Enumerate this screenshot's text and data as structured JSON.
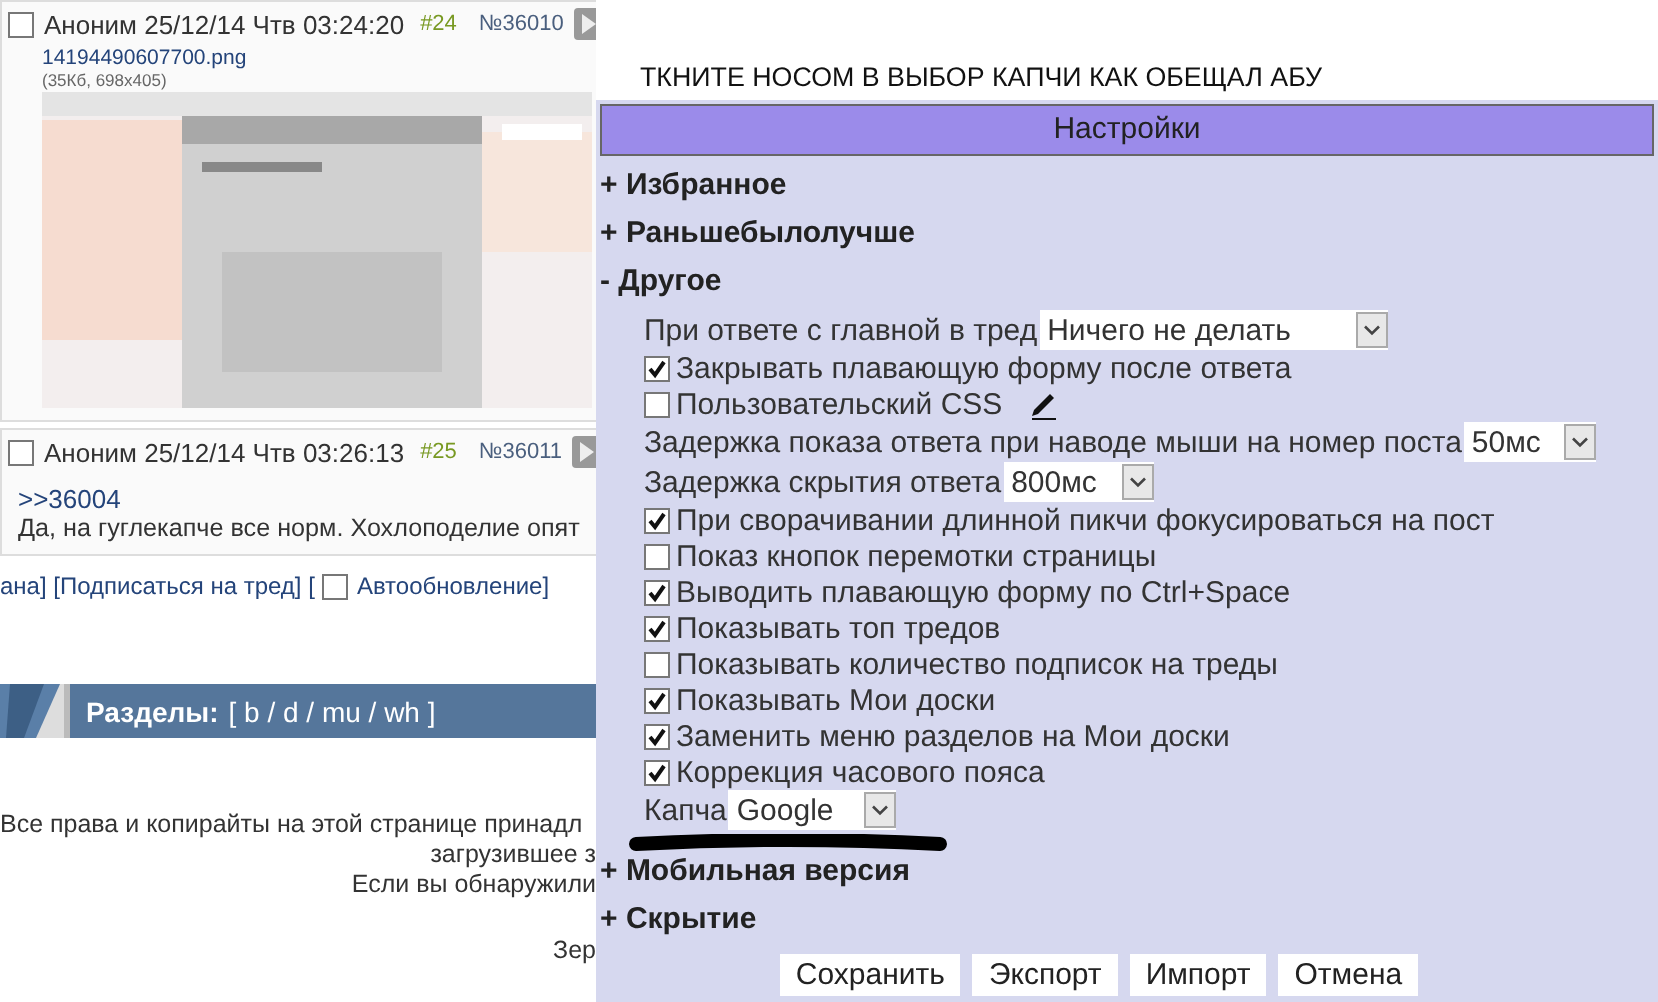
{
  "posts": [
    {
      "checked": false,
      "author": "Аноним",
      "date": "25/12/14 Чтв 03:24:20",
      "index": "#24",
      "number": "№36010",
      "file_name": "14194490607700.png",
      "file_info": "(35Кб, 698x405)"
    },
    {
      "checked": false,
      "author": "Аноним",
      "date": "25/12/14 Чтв 03:26:13",
      "index": "#25",
      "number": "№36011",
      "reply_link": ">>36004",
      "text": "Да, на гуглекапче все норм. Хохлоподелие опят"
    }
  ],
  "thread_links": {
    "before": "ана] [Подписаться на тред] [",
    "autoupdate_checked": false,
    "after": "Автообновление]"
  },
  "boards_bar": {
    "label": "Разделы:",
    "boards": "[ b / d / mu / wh ]"
  },
  "footer": [
    "Все права и копирайты на этой странице принадл",
    "загрузившее з",
    "Если вы обнаружили",
    "Зер"
  ],
  "notice": "ТКНИТЕ НОСОМ В ВЫБОР КАПЧИ КАК ОБЕЩАЛ АБУ",
  "settings": {
    "title": "Настройки",
    "sections": [
      {
        "sign": "+",
        "label": "Избранное"
      },
      {
        "sign": "+",
        "label": "Раньшебылолучше"
      },
      {
        "sign": "-",
        "label": "Другое",
        "options": [
          {
            "kind": "select",
            "label": "При ответе с главной в тред",
            "value": "Ничего не делать"
          },
          {
            "kind": "checkbox",
            "label": "Закрывать плавающую форму после ответа",
            "checked": true
          },
          {
            "kind": "checkbox",
            "label": "Пользовательский CSS",
            "checked": false,
            "editable": true
          },
          {
            "kind": "select",
            "label": "Задержка показа ответа при наводе мыши на номер поста",
            "value": "50мс"
          },
          {
            "kind": "select",
            "label": "Задержка скрытия ответа",
            "value": "800мс"
          },
          {
            "kind": "checkbox",
            "label": "При сворачивании длинной пикчи фокусироваться на пост",
            "checked": true
          },
          {
            "kind": "checkbox",
            "label": "Показ кнопок перемотки страницы",
            "checked": false
          },
          {
            "kind": "checkbox",
            "label": "Выводить плавающую форму по Ctrl+Space",
            "checked": true
          },
          {
            "kind": "checkbox",
            "label": "Показывать топ тредов",
            "checked": true
          },
          {
            "kind": "checkbox",
            "label": "Показывать количество подписок на треды",
            "checked": false
          },
          {
            "kind": "checkbox",
            "label": "Показывать Мои доски",
            "checked": true
          },
          {
            "kind": "checkbox",
            "label": "Заменить меню разделов на Мои доски",
            "checked": true
          },
          {
            "kind": "checkbox",
            "label": "Коррекция часового пояса",
            "checked": true
          },
          {
            "kind": "select",
            "label": "Капча",
            "value": "Google",
            "scribbled": true
          }
        ]
      },
      {
        "sign": "+",
        "label": "Мобильная версия"
      },
      {
        "sign": "+",
        "label": "Скрытие"
      }
    ],
    "buttons": [
      "Сохранить",
      "Экспорт",
      "Импорт",
      "Отмена"
    ]
  }
}
